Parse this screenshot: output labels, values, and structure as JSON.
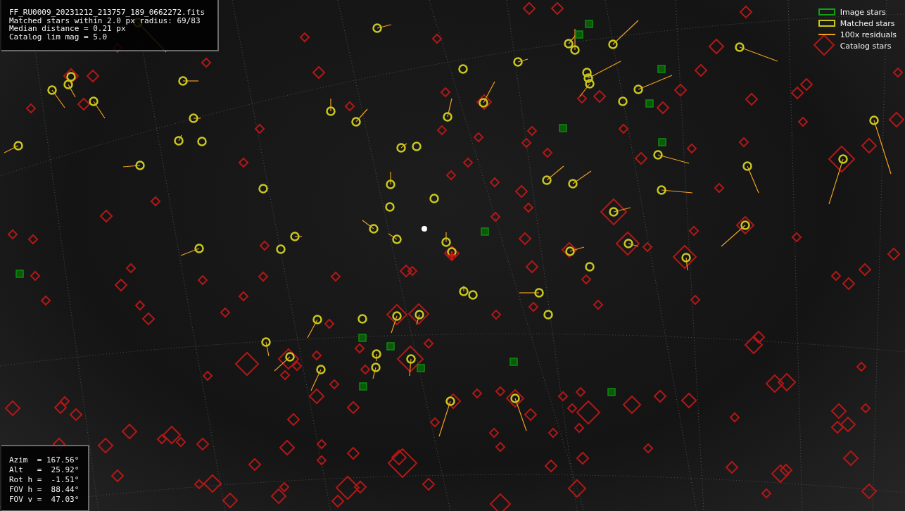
{
  "info_box": {
    "lines": [
      "FF_RU0009_20231212_213757_189_0662272.fits",
      "Matched stars within 2.0 px radius: 69/83",
      "Median distance = 0.21 px",
      "Catalog lim mag = 5.0"
    ]
  },
  "legend": [
    {
      "kind": "image",
      "label": "Image stars"
    },
    {
      "kind": "matched",
      "label": "Matched stars"
    },
    {
      "kind": "residual",
      "label": "100x residuals"
    },
    {
      "kind": "catalog",
      "label": "Catalog stars"
    }
  ],
  "pointing_box": {
    "lines": [
      "Azim  = 167.56°",
      "Alt   =  25.92°",
      "Rot h =  -1.51°",
      "FOV h =  88.44°",
      "FOV v =  47.03°"
    ]
  }
}
